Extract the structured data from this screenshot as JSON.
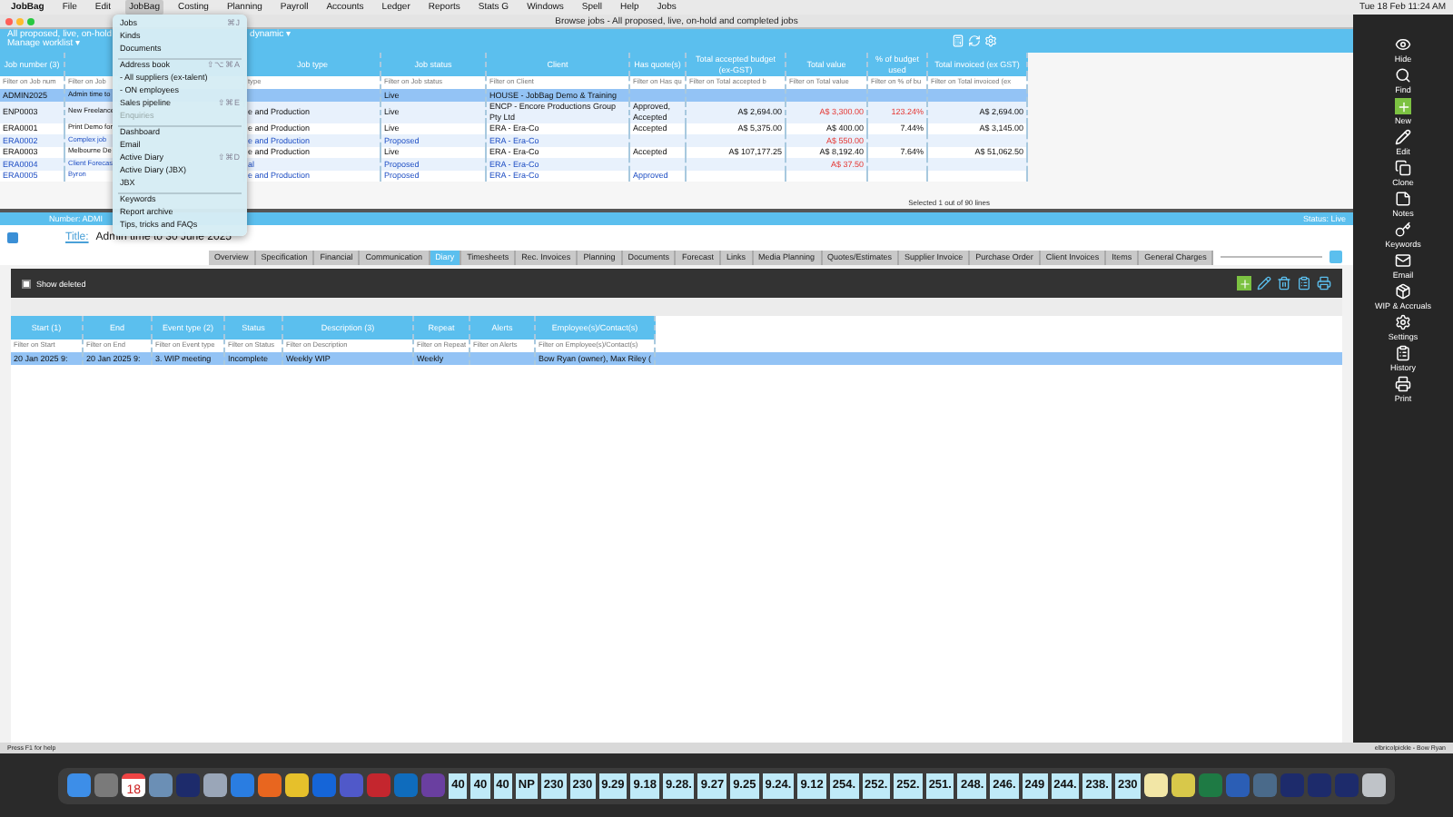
{
  "menu_bar": {
    "items": [
      {
        "label": "JobBag",
        "selected": false
      },
      {
        "label": "File",
        "selected": false
      },
      {
        "label": "Edit",
        "selected": false
      },
      {
        "label": "JobBag",
        "selected": true
      },
      {
        "label": "Costing",
        "selected": false
      },
      {
        "label": "Planning",
        "selected": false
      },
      {
        "label": "Payroll",
        "selected": false
      },
      {
        "label": "Accounts",
        "selected": false
      },
      {
        "label": "Ledger",
        "selected": false
      },
      {
        "label": "Reports",
        "selected": false
      },
      {
        "label": "Stats G",
        "selected": false
      },
      {
        "label": "Windows",
        "selected": false
      },
      {
        "label": "Spell",
        "selected": false
      },
      {
        "label": "Help",
        "selected": false
      },
      {
        "label": "Jobs",
        "selected": false
      }
    ],
    "clock": "Tue 18 Feb 11:24 AM"
  },
  "window": {
    "title": "Browse jobs - All proposed, live, on-hold and completed jobs"
  },
  "browse": {
    "view_name": "All proposed, live, on-hold",
    "view_suffix": "dynamic ▾",
    "worklist": "Manage worklist ▾",
    "columns": [
      "Job number (3)",
      null,
      "Job type",
      "Job status",
      "Client",
      "Has quote(s)",
      "Total accepted budget (ex-GST)",
      "Total value",
      "% of budget used",
      "Total invoiced (ex GST)"
    ],
    "filters": [
      "Filter on Job num",
      "Filter on Job",
      "type",
      "Filter on Job status",
      "Filter on Client",
      "Filter on Has qu",
      "Filter on Total accepted b",
      "Filter on Total value",
      "Filter on % of bu",
      "Filter on Total invoiced (ex"
    ],
    "rows": [
      {
        "selected": true,
        "proposed": false,
        "cells": [
          "ADMIN2025",
          "Admin time to",
          null,
          "Live",
          "HOUSE - JobBag Demo & Training",
          null,
          null,
          null,
          null,
          null
        ]
      },
      {
        "selected": false,
        "proposed": false,
        "over_budget": true,
        "cells": [
          "ENP0003",
          "New Freelance",
          "e and Production",
          "Live",
          "ENCP - Encore Productions Group Pty Ltd",
          "Approved, Accepted",
          "A$ 2,694.00",
          "A$ 3,300.00",
          "123.24%",
          "A$ 2,694.00"
        ]
      },
      {
        "selected": false,
        "proposed": false,
        "over_budget": false,
        "cells": [
          "ERA0001",
          "Print Demo for",
          "e and Production",
          "Live",
          "ERA - Era-Co",
          "Accepted",
          "A$ 5,375.00",
          "A$ 400.00",
          "7.44%",
          "A$ 3,145.00"
        ]
      },
      {
        "selected": false,
        "proposed": true,
        "over_budget": true,
        "cells": [
          "ERA0002",
          "Complex job",
          "e and Production",
          "Proposed",
          "ERA - Era-Co",
          null,
          null,
          "A$ 550.00",
          null,
          null
        ]
      },
      {
        "selected": false,
        "proposed": false,
        "over_budget": false,
        "cells": [
          "ERA0003",
          "Melbourne De",
          "e and Production",
          "Live",
          "ERA - Era-Co",
          "Accepted",
          "A$ 107,177.25",
          "A$ 8,192.40",
          "7.64%",
          "A$ 51,062.50"
        ]
      },
      {
        "selected": false,
        "proposed": true,
        "over_budget": true,
        "cells": [
          "ERA0004",
          "Client Forecas",
          "al",
          "Proposed",
          "ERA - Era-Co",
          null,
          null,
          "A$ 37.50",
          null,
          null
        ]
      },
      {
        "selected": false,
        "proposed": true,
        "cells": [
          "ERA0005",
          "Byron",
          "e and Production",
          "Proposed",
          "ERA - Era-Co",
          "Approved",
          null,
          null,
          null,
          null
        ]
      }
    ],
    "selection_text": "Selected 1 out of 90 lines"
  },
  "dropdown": {
    "items": [
      {
        "kind": "item",
        "label": "Jobs",
        "shortcut": "⌘J",
        "disabled": false
      },
      {
        "kind": "item",
        "label": "Kinds",
        "disabled": false
      },
      {
        "kind": "item",
        "label": "Documents",
        "disabled": false
      },
      {
        "kind": "separator"
      },
      {
        "kind": "item",
        "label": "Address book",
        "shortcut": "⇧⌥⌘A",
        "disabled": false
      },
      {
        "kind": "item",
        "label": "- All suppliers (ex-talent)",
        "disabled": false
      },
      {
        "kind": "item",
        "label": "- ON employees",
        "disabled": false
      },
      {
        "kind": "item",
        "label": "Sales pipeline",
        "shortcut": "⇧⌘E",
        "disabled": false
      },
      {
        "kind": "item",
        "label": "Enquiries",
        "disabled": true
      },
      {
        "kind": "separator"
      },
      {
        "kind": "item",
        "label": "Dashboard",
        "disabled": false
      },
      {
        "kind": "item",
        "label": "Email",
        "disabled": false
      },
      {
        "kind": "item",
        "label": "Active Diary",
        "shortcut": "⇧⌘D",
        "disabled": false
      },
      {
        "kind": "item",
        "label": "Active Diary (JBX)",
        "disabled": false
      },
      {
        "kind": "item",
        "label": "JBX",
        "disabled": false
      },
      {
        "kind": "separator"
      },
      {
        "kind": "item",
        "label": "Keywords",
        "disabled": false
      },
      {
        "kind": "item",
        "label": "Report archive",
        "disabled": false
      },
      {
        "kind": "item",
        "label": "Tips, tricks and FAQs",
        "disabled": false
      }
    ]
  },
  "job": {
    "number_label": "Number:",
    "number": "ADMI",
    "status": "Status: Live",
    "title_label": "Title:",
    "title": "Admin time to 30 June 2025",
    "tabs": [
      {
        "label": "Overview",
        "selected": false
      },
      {
        "label": "Specification",
        "selected": false
      },
      {
        "label": "Financial",
        "selected": false
      },
      {
        "label": "Communication",
        "selected": false
      },
      {
        "label": "Diary",
        "selected": true
      },
      {
        "label": "Timesheets",
        "selected": false
      },
      {
        "label": "Rec. Invoices",
        "selected": false
      },
      {
        "label": "Planning",
        "selected": false
      },
      {
        "label": "Documents",
        "selected": false
      },
      {
        "label": "Forecast",
        "selected": false
      },
      {
        "label": "Links",
        "selected": false
      },
      {
        "label": "Media Planning",
        "selected": false
      },
      {
        "label": "Quotes/Estimates",
        "selected": false
      },
      {
        "label": "Supplier Invoice",
        "selected": false
      },
      {
        "label": "Purchase Order",
        "selected": false
      },
      {
        "label": "Client Invoices",
        "selected": false
      },
      {
        "label": "Items",
        "selected": false
      },
      {
        "label": "General Charges",
        "selected": false
      }
    ]
  },
  "diary": {
    "show_deleted": {
      "label": "Show deleted",
      "checked": false
    },
    "columns": [
      "Start (1)",
      "End",
      "Event type (2)",
      "Status",
      "Description (3)",
      "Repeat",
      "Alerts",
      "Employee(s)/Contact(s)"
    ],
    "filters": [
      "Filter on Start",
      "Filter on End",
      "Filter on Event type",
      "Filter on Status",
      "Filter on Description",
      "Filter on Repeat",
      "Filter on Alerts",
      "Filter on Employee(s)/Contact(s)"
    ],
    "rows": [
      {
        "selected": true,
        "cells": [
          "20 Jan 2025 9:",
          "20 Jan 2025 9:",
          "3. WIP meeting",
          "Incomplete",
          "Weekly WIP",
          "Weekly",
          null,
          "Bow Ryan (owner), Max Riley ("
        ]
      }
    ]
  },
  "sidebar": [
    {
      "kind": "eye",
      "label": "Hide"
    },
    {
      "kind": "search",
      "label": "Find"
    },
    {
      "kind": "new",
      "label": "New"
    },
    {
      "kind": "edit",
      "label": "Edit"
    },
    {
      "kind": "clone",
      "label": "Clone"
    },
    {
      "kind": "notes",
      "label": "Notes"
    },
    {
      "kind": "key",
      "label": "Keywords"
    },
    {
      "kind": "mail",
      "label": "Email"
    },
    {
      "kind": "box",
      "label": "WIP & Accruals"
    },
    {
      "kind": "gear",
      "label": "Settings"
    },
    {
      "kind": "clipboard",
      "label": "History"
    },
    {
      "kind": "print",
      "label": "Print"
    }
  ],
  "status_bar": {
    "left": "Press F1 for help",
    "right": "elbricolpickle - Bow Ryan"
  },
  "dock": [
    {
      "kind": "app",
      "color": "#3d8ee8"
    },
    {
      "kind": "app",
      "color": "#7a7a7a"
    },
    {
      "kind": "calendar",
      "label": "18"
    },
    {
      "kind": "app",
      "color": "#6b8fb5"
    },
    {
      "kind": "app",
      "color": "#1d2b6b"
    },
    {
      "kind": "app",
      "color": "#9aa6b8"
    },
    {
      "kind": "app",
      "color": "#2a7de1"
    },
    {
      "kind": "app",
      "color": "#e8661f"
    },
    {
      "kind": "app",
      "color": "#e6c02b"
    },
    {
      "kind": "app",
      "color": "#1565d8"
    },
    {
      "kind": "app",
      "color": "#5059c9"
    },
    {
      "kind": "app",
      "color": "#c4262e"
    },
    {
      "kind": "app",
      "color": "#0f6cbd"
    },
    {
      "kind": "app",
      "color": "#6a3fa0"
    },
    {
      "kind": "number",
      "label": "40"
    },
    {
      "kind": "number",
      "label": "40"
    },
    {
      "kind": "number",
      "label": "40"
    },
    {
      "kind": "number",
      "label": "NP"
    },
    {
      "kind": "number",
      "label": "230"
    },
    {
      "kind": "number",
      "label": "230"
    },
    {
      "kind": "number",
      "label": "9.29"
    },
    {
      "kind": "number",
      "label": "9.18"
    },
    {
      "kind": "number",
      "label": "9.28."
    },
    {
      "kind": "number",
      "label": "9.27"
    },
    {
      "kind": "number",
      "label": "9.25"
    },
    {
      "kind": "number",
      "label": "9.24."
    },
    {
      "kind": "number",
      "label": "9.12"
    },
    {
      "kind": "number",
      "label": "254."
    },
    {
      "kind": "number",
      "label": "252."
    },
    {
      "kind": "number",
      "label": "252."
    },
    {
      "kind": "number",
      "label": "251."
    },
    {
      "kind": "number",
      "label": "248."
    },
    {
      "kind": "number",
      "label": "246."
    },
    {
      "kind": "number",
      "label": "249"
    },
    {
      "kind": "number",
      "label": "244."
    },
    {
      "kind": "number",
      "label": "238."
    },
    {
      "kind": "number",
      "label": "230"
    },
    {
      "kind": "app",
      "color": "#f2e6a6"
    },
    {
      "kind": "app",
      "color": "#d8c84a"
    },
    {
      "kind": "app",
      "color": "#1e7a44"
    },
    {
      "kind": "app",
      "color": "#2b5eb5"
    },
    {
      "kind": "app",
      "color": "#4a6a8a"
    },
    {
      "kind": "app",
      "color": "#1d2b6b"
    },
    {
      "kind": "app",
      "color": "#1d2b6b"
    },
    {
      "kind": "app",
      "color": "#1d2b6b"
    },
    {
      "kind": "app",
      "color": "#bfc3c8"
    }
  ]
}
